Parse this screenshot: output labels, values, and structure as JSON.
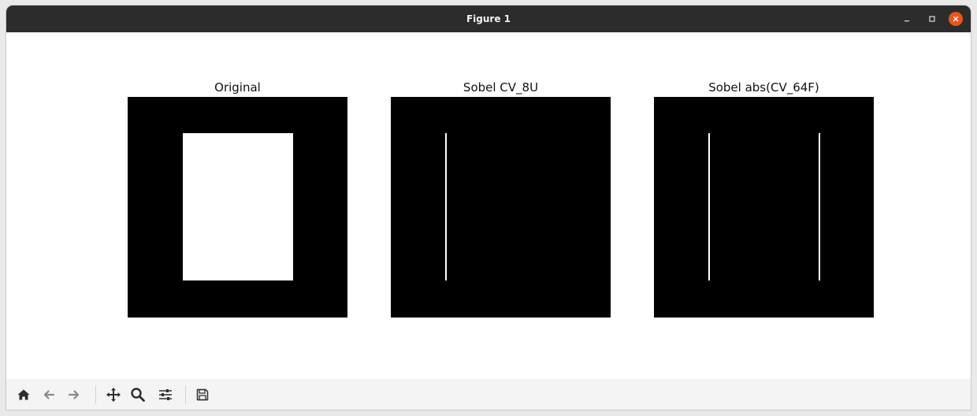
{
  "window": {
    "title": "Figure 1"
  },
  "figure": {
    "panels": [
      {
        "title": "Original"
      },
      {
        "title": "Sobel CV_8U"
      },
      {
        "title": "Sobel abs(CV_64F)"
      }
    ]
  },
  "toolbar": {
    "icons": [
      "home-icon",
      "back-icon",
      "forward-icon",
      "pan-icon",
      "zoom-icon",
      "configure-subplots-icon",
      "save-icon"
    ]
  },
  "colors": {
    "titlebar": "#2c2c2c",
    "close_button": "#e95420",
    "image_background": "#000000",
    "edge": "#ffffff"
  }
}
